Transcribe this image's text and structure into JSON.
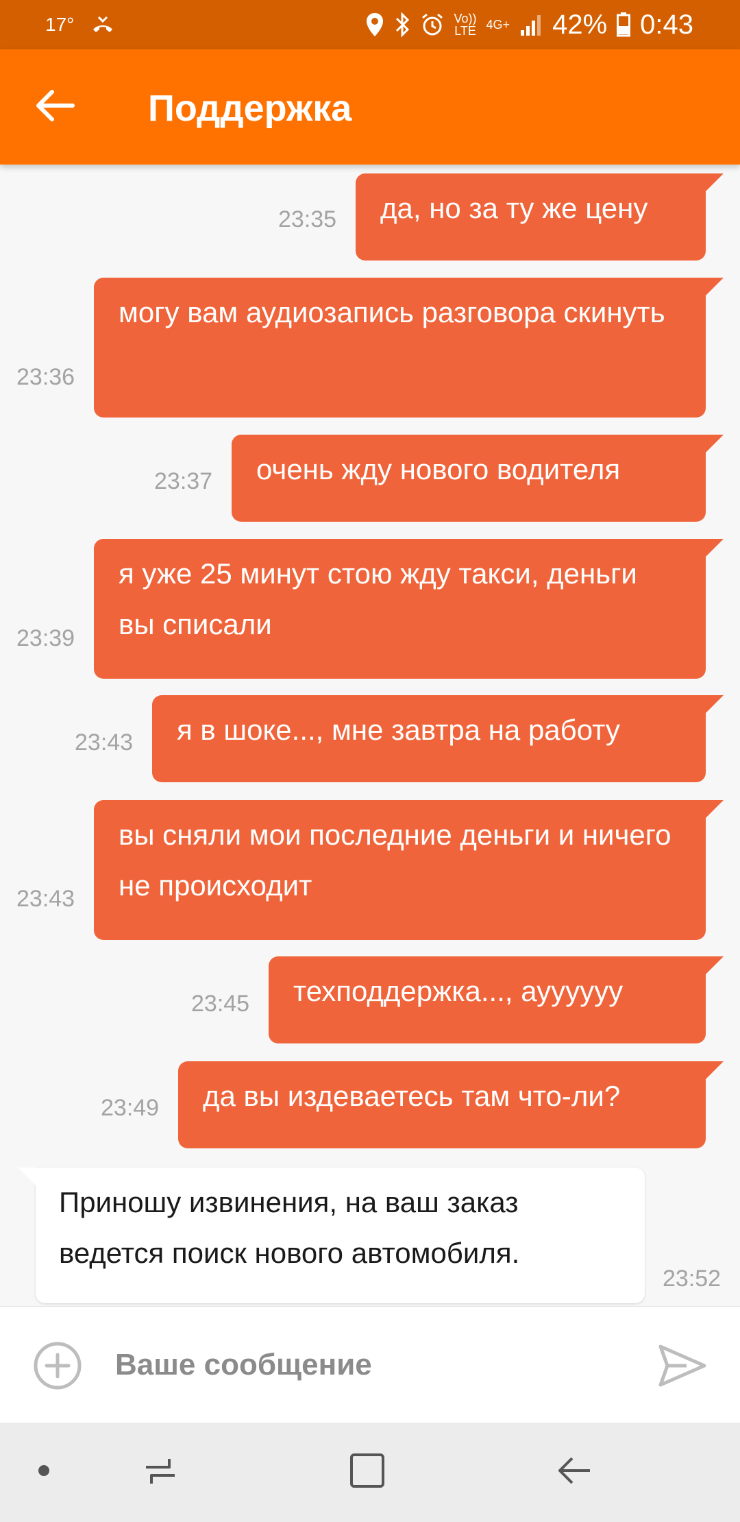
{
  "status_bar": {
    "temperature": "17°",
    "network_top": "4G+",
    "volte_top": "Vo))",
    "volte_bottom": "LTE",
    "battery": "42%",
    "time": "0:43"
  },
  "header": {
    "title": "Поддержка"
  },
  "messages": [
    {
      "direction": "out",
      "text": "да, но за ту же цену",
      "time": "23:35"
    },
    {
      "direction": "out",
      "text": "могу вам аудиозапись разговора скинуть",
      "time": "23:36"
    },
    {
      "direction": "out",
      "text": "очень жду нового водителя",
      "time": "23:37"
    },
    {
      "direction": "out",
      "text": "я уже 25 минут стою жду такси, деньги вы списали",
      "time": "23:39"
    },
    {
      "direction": "out",
      "text": "я в шоке..., мне завтра на работу",
      "time": "23:43"
    },
    {
      "direction": "out",
      "text": "вы сняли мои последние деньги и ничего не происходит",
      "time": "23:43"
    },
    {
      "direction": "out",
      "text": "техподдержка..., ауууууу",
      "time": "23:45"
    },
    {
      "direction": "out",
      "text": "да вы издеваетесь там что-ли?",
      "time": "23:49"
    },
    {
      "direction": "in",
      "text": "Приношу извинения, на ваш заказ ведется поиск нового автомобиля.",
      "time": "23:52"
    }
  ],
  "composer": {
    "placeholder": "Ваше сообщение"
  },
  "colors": {
    "status_bar": "#d35f00",
    "app_bar": "#ff7200",
    "outgoing_bubble": "#ef643a",
    "incoming_bubble": "#ffffff",
    "background": "#f7f7f7"
  },
  "icons": {
    "back": "arrow-left-icon",
    "add": "plus-circle-icon",
    "send": "send-icon",
    "nav_dot": "dot-icon",
    "nav_recents": "recents-icon",
    "nav_home": "home-icon",
    "nav_back": "back-icon"
  }
}
